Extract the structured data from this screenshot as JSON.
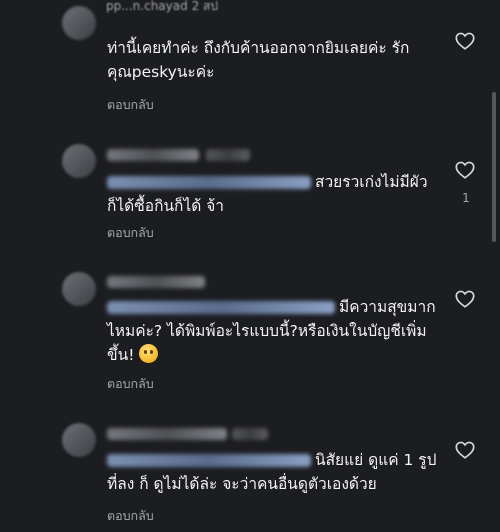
{
  "comments": [
    {
      "username": "pp...n.chayad",
      "time": "2 สป",
      "text": "ท่านี้เคยทำค่ะ ถึงกับค้านออกจากยิมเลยค่ะ รักคุณpeskyนะค่ะ",
      "reply_label": "ตอบกลับ",
      "likes": ""
    },
    {
      "username": "",
      "mention": "@...ngphathirawngeonnaa",
      "text": "สวยรวเก่งไม่มีผัวก็ได้ซื้อกินก็ได้ จ้า",
      "reply_label": "ตอบกลับ",
      "likes": "1"
    },
    {
      "username": "",
      "mention": "",
      "text": "มีความสุขมากไหมค่ะ? ได้พิมพ์อะไรแบบนี้?หรือเงินในบัญชีเพิ่มขึ้น!",
      "emoji": "thinking-face",
      "reply_label": "ตอบกลับ",
      "likes": ""
    },
    {
      "username": "",
      "mention": "@...ngphathirawngeonnaa",
      "text": "นิสัยแย่ ดูแค่ 1 รูป ที่ลง ก็ ดูไม่ได้ล่ะ จะว่าคนอื่นดูตัวเองด้วย",
      "reply_label": "ตอบกลับ",
      "likes": ""
    }
  ],
  "icons": {
    "like": "heart-outline-icon"
  },
  "colors": {
    "background": "#1c1d21",
    "text": "#f4f4f4",
    "secondary": "#a4a6ab"
  }
}
